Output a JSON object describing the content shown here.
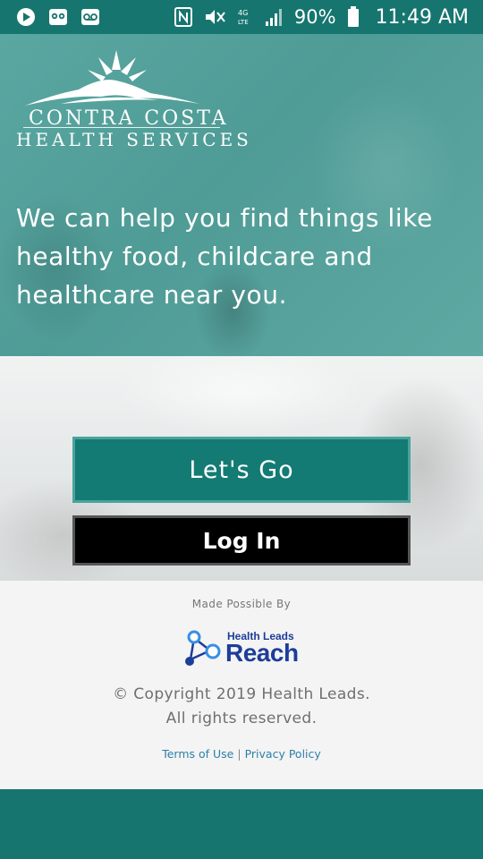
{
  "status_bar": {
    "battery_percent": "90%",
    "time": "11:49 AM",
    "left_icons": [
      "play-circle-icon",
      "owl-icon",
      "voicemail-icon"
    ],
    "right_icons": [
      "nfc-icon",
      "mute-icon",
      "4g-lte-icon",
      "signal-icon",
      "battery-icon"
    ]
  },
  "hero": {
    "logo": {
      "line1": "CONTRA COSTA",
      "line2": "HEALTH SERVICES"
    },
    "tagline": "We can help you find things like healthy food, childcare and healthcare near you."
  },
  "actions": {
    "lets_go_label": "Let's Go",
    "login_label": "Log In"
  },
  "footer": {
    "made_possible": "Made Possible By",
    "partner_logo": {
      "small_text": "Health Leads",
      "big_text": "Reach"
    },
    "copyright_line1": "© Copyright 2019 Health Leads.",
    "copyright_line2": "All rights reserved.",
    "terms_label": "Terms of Use",
    "separator": "|",
    "privacy_label": "Privacy Policy"
  },
  "colors": {
    "primary_teal": "#137b74",
    "status_bar": "#16756f",
    "link_blue": "#2e7fa8",
    "reach_blue": "#1d3d9a"
  }
}
